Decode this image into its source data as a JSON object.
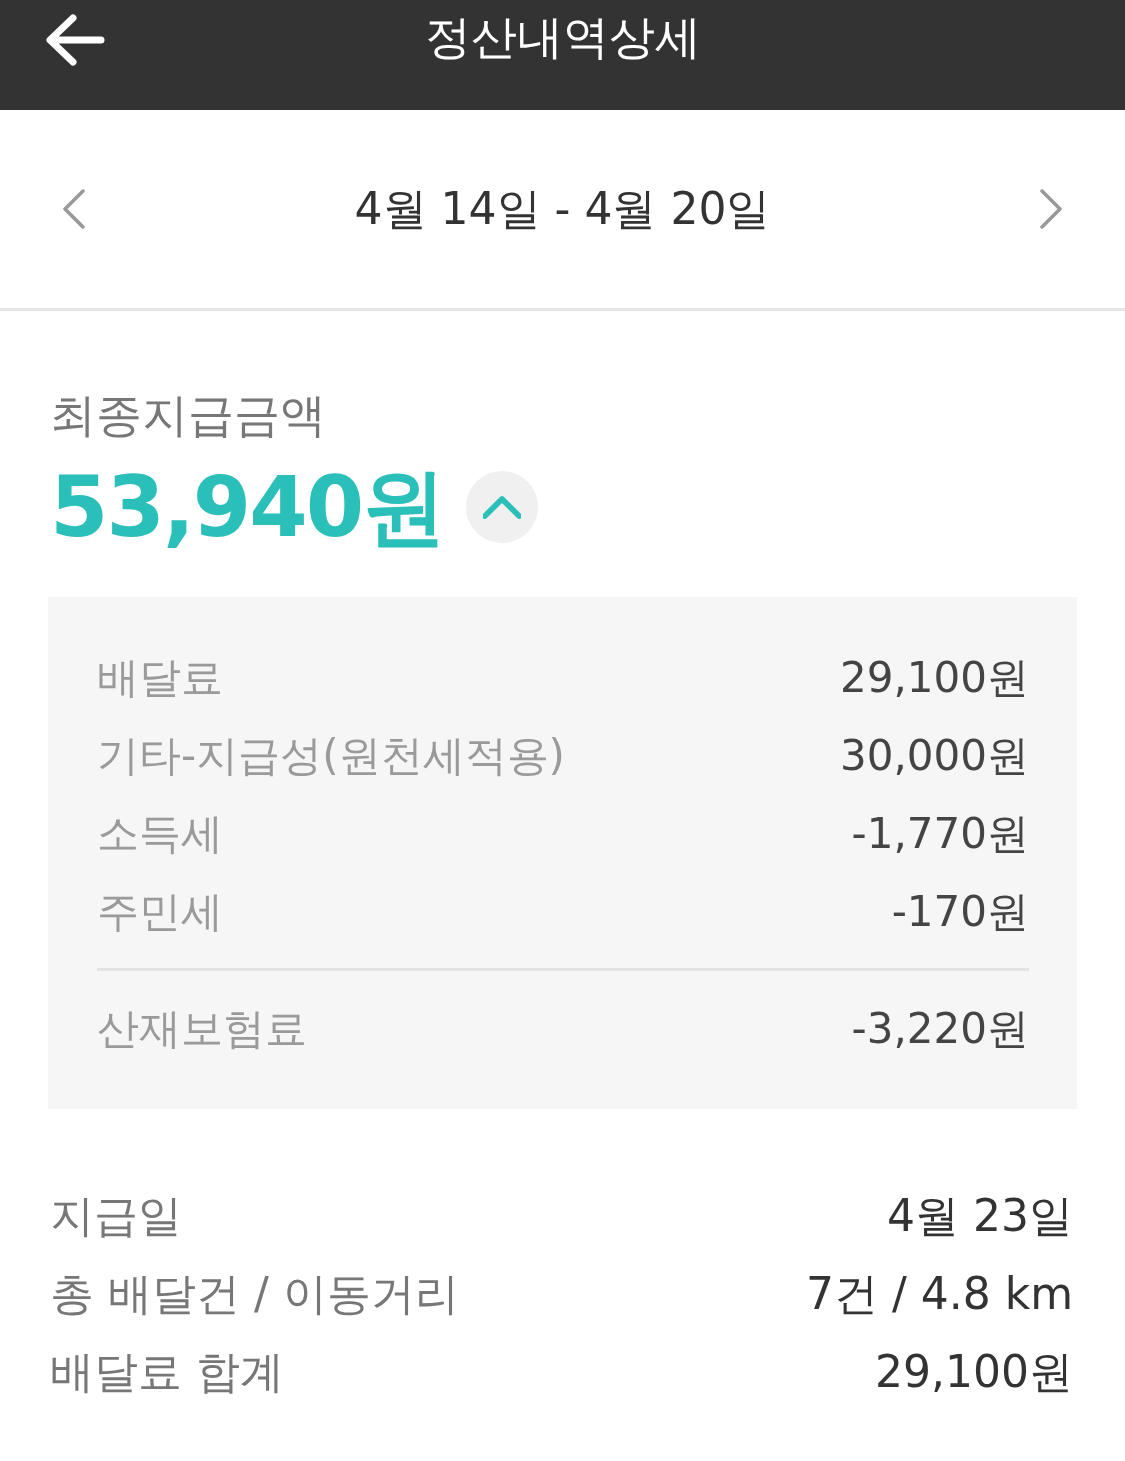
{
  "header": {
    "title": "정산내역상세"
  },
  "period": {
    "label": "4월 14일 - 4월 20일"
  },
  "summary": {
    "label": "최종지급금액",
    "amount": "53,940원",
    "expanded": true
  },
  "breakdown": {
    "groups": [
      {
        "rows": [
          {
            "label": "배달료",
            "value": "29,100원"
          },
          {
            "label": "기타-지급성(원천세적용)",
            "value": "30,000원"
          },
          {
            "label": "소득세",
            "value": "-1,770원"
          },
          {
            "label": "주민세",
            "value": "-170원"
          }
        ]
      },
      {
        "rows": [
          {
            "label": "산재보험료",
            "value": "-3,220원"
          }
        ]
      }
    ]
  },
  "details": [
    {
      "label": "지급일",
      "value": "4월 23일"
    },
    {
      "label": "총 배달건 / 이동거리",
      "value": "7건 / 4.8 km"
    },
    {
      "label": "배달료 합계",
      "value": "29,100원"
    }
  ]
}
